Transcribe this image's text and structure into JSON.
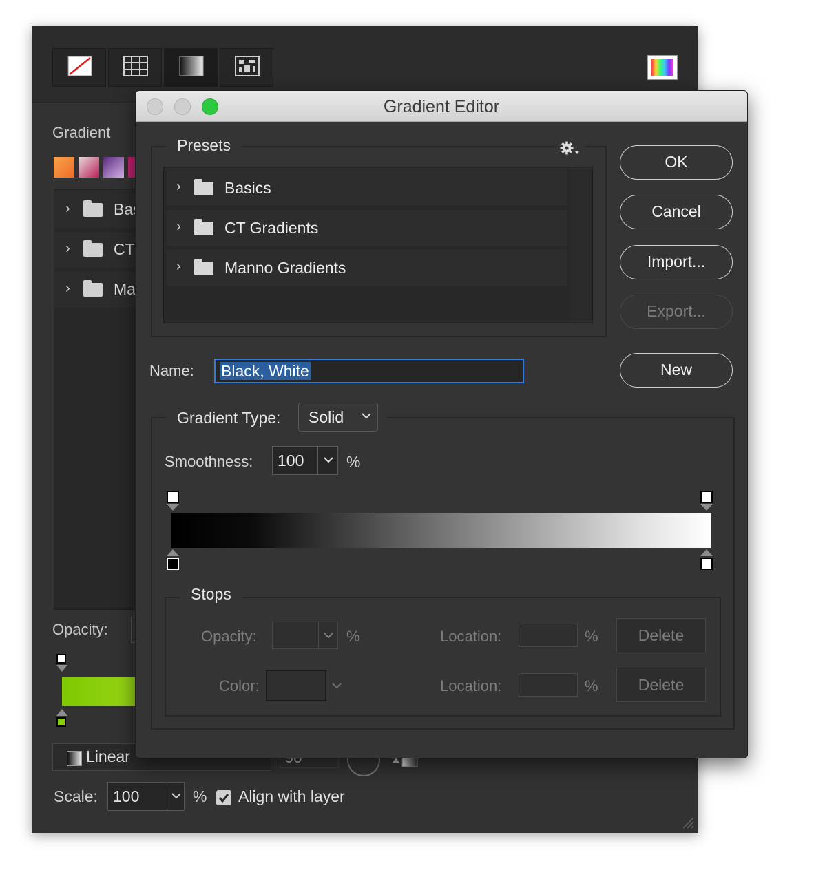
{
  "background_panel": {
    "fill_type_buttons": [
      "no-fill",
      "pattern-grid",
      "gradient-fill",
      "pattern-fill"
    ],
    "gradient_label": "Gradient",
    "preset_swatches": [
      {
        "from": "#f7a54a",
        "to": "#f06a28"
      },
      {
        "from": "#e6dada",
        "to": "#b8205a"
      },
      {
        "from": "#5a2a7a",
        "to": "#d9b5f0"
      }
    ],
    "folder_items": [
      {
        "label": "Bas"
      },
      {
        "label": "CT"
      },
      {
        "label": "Ma"
      }
    ],
    "opacity_label": "Opacity:",
    "gradient_colors": {
      "start": "#7fc800",
      "end": "#9bd81a",
      "color_stop": "#8acd0c"
    },
    "style_select_value": "Linear",
    "angle_value": "90",
    "scale_label": "Scale:",
    "scale_value": "100",
    "scale_unit": "%",
    "align_with_layer_checked": true,
    "align_with_layer_label": "Align with layer"
  },
  "dialog": {
    "title": "Gradient Editor",
    "presets": {
      "legend": "Presets",
      "items": [
        {
          "label": "Basics"
        },
        {
          "label": "CT Gradients"
        },
        {
          "label": "Manno Gradients"
        }
      ]
    },
    "buttons": {
      "ok": "OK",
      "cancel": "Cancel",
      "import": "Import...",
      "export": "Export...",
      "new": "New"
    },
    "name_label": "Name:",
    "name_value": "Black, White",
    "gradient_type_label": "Gradient Type:",
    "gradient_type_value": "Solid",
    "smoothness_label": "Smoothness:",
    "smoothness_value": "100",
    "smoothness_unit": "%",
    "gradient": {
      "start_color": "#000000",
      "end_color": "#ffffff"
    },
    "stops": {
      "legend": "Stops",
      "opacity_label": "Opacity:",
      "opacity_value": "",
      "color_label": "Color:",
      "location_label": "Location:",
      "location_value": "",
      "unit": "%",
      "delete_label": "Delete"
    }
  }
}
